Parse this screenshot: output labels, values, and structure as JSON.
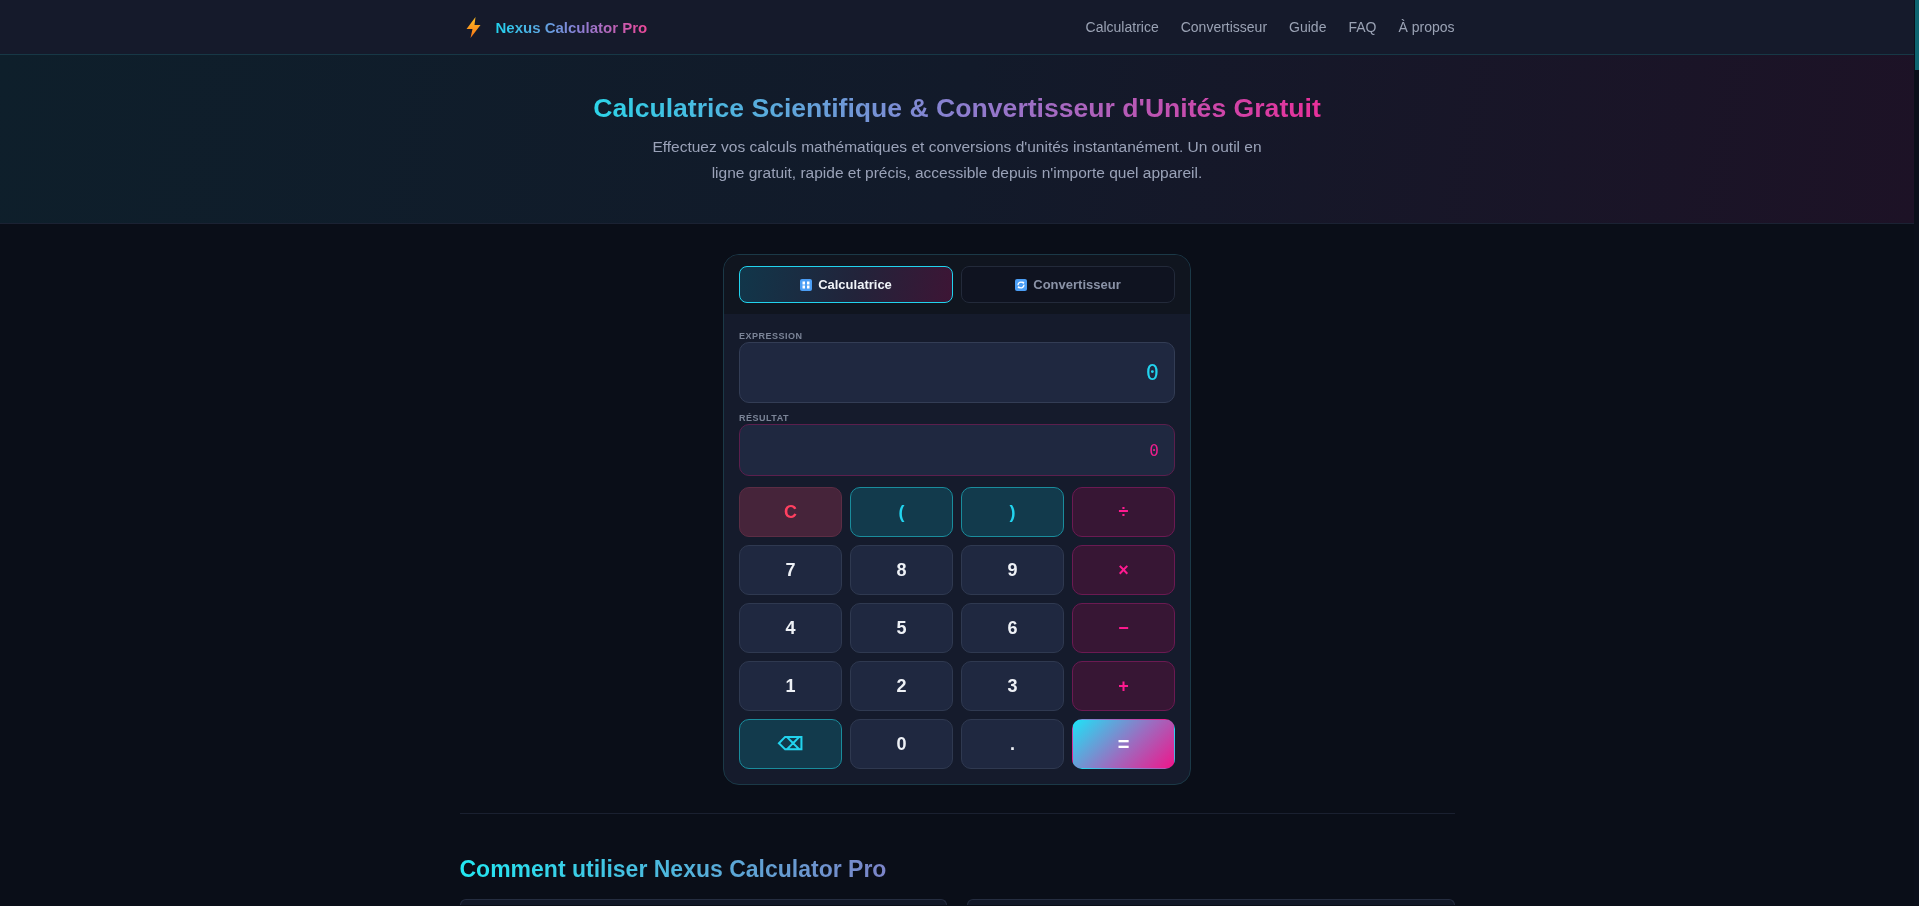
{
  "header": {
    "brand": "Nexus Calculator Pro",
    "nav": [
      "Calculatrice",
      "Convertisseur",
      "Guide",
      "FAQ",
      "À propos"
    ]
  },
  "hero": {
    "title": "Calculatrice Scientifique & Convertisseur d'Unités Gratuit",
    "subtitle": "Effectuez vos calculs mathématiques et conversions d'unités instantanément. Un outil en ligne gratuit, rapide et précis, accessible depuis n'importe quel appareil."
  },
  "calculator": {
    "tabs": [
      {
        "label": "Calculatrice",
        "selected": true
      },
      {
        "label": "Convertisseur",
        "selected": false
      }
    ],
    "expression": {
      "label": "EXPRESSION",
      "value": "0"
    },
    "result": {
      "label": "RÉSULTAT",
      "value": "0"
    },
    "keys": [
      {
        "label": "C",
        "kind": "clear"
      },
      {
        "label": "(",
        "kind": "paren"
      },
      {
        "label": ")",
        "kind": "paren"
      },
      {
        "label": "÷",
        "kind": "operator"
      },
      {
        "label": "7",
        "kind": "digit"
      },
      {
        "label": "8",
        "kind": "digit"
      },
      {
        "label": "9",
        "kind": "digit"
      },
      {
        "label": "×",
        "kind": "operator"
      },
      {
        "label": "4",
        "kind": "digit"
      },
      {
        "label": "5",
        "kind": "digit"
      },
      {
        "label": "6",
        "kind": "digit"
      },
      {
        "label": "−",
        "kind": "operator"
      },
      {
        "label": "1",
        "kind": "digit"
      },
      {
        "label": "2",
        "kind": "digit"
      },
      {
        "label": "3",
        "kind": "digit"
      },
      {
        "label": "+",
        "kind": "operator"
      },
      {
        "label": "⌫",
        "kind": "backspace"
      },
      {
        "label": "0",
        "kind": "digit"
      },
      {
        "label": ".",
        "kind": "point"
      },
      {
        "label": "=",
        "kind": "equals"
      }
    ]
  },
  "guide": {
    "title": "Comment utiliser Nexus Calculator Pro"
  }
}
